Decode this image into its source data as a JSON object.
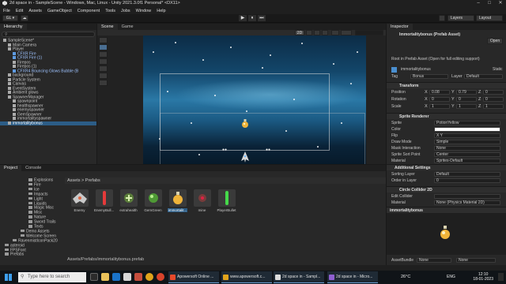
{
  "window": {
    "title": "2d space in - SampleScene - Windows, Mac, Linux - Unity 2021.3.0f1 Personal* <DX11>",
    "controls": [
      "–",
      "□",
      "✕"
    ]
  },
  "menu": [
    "File",
    "Edit",
    "Assets",
    "GameObject",
    "Component",
    "Tools",
    "Jobs",
    "Window",
    "Help"
  ],
  "toolbar": {
    "account": "GL ▾",
    "cloud": "☁",
    "play": "▶",
    "pause": "⏸",
    "step": "⏭",
    "layers": "Layers",
    "layout": "Layout"
  },
  "hierarchy": {
    "tab": "Hierarchy",
    "search_placeholder": "All",
    "items": [
      {
        "label": "SampleScene*",
        "depth": 0,
        "color": "white"
      },
      {
        "label": "Main Camera",
        "depth": 1,
        "color": "white"
      },
      {
        "label": "Player",
        "depth": 1,
        "color": "white"
      },
      {
        "label": "CFXR Fire",
        "depth": 2,
        "color": "blue"
      },
      {
        "label": "CFXR Fire (1)",
        "depth": 2,
        "color": "blue"
      },
      {
        "label": "Firepos",
        "depth": 2,
        "color": "white"
      },
      {
        "label": "Firepos (1)",
        "depth": 2,
        "color": "white"
      },
      {
        "label": "CFXR4 Bouncing Glows Bubble (B",
        "depth": 2,
        "color": "blue"
      },
      {
        "label": "background",
        "depth": 1,
        "color": "white"
      },
      {
        "label": "Particle System",
        "depth": 1,
        "color": "white"
      },
      {
        "label": "Canvas",
        "depth": 1,
        "color": "white"
      },
      {
        "label": "EventSystem",
        "depth": 1,
        "color": "white"
      },
      {
        "label": "Ambient glows",
        "depth": 1,
        "color": "white"
      },
      {
        "label": "SpawnerManager",
        "depth": 1,
        "color": "white"
      },
      {
        "label": "spawnpoint",
        "depth": 2,
        "color": "white"
      },
      {
        "label": "healthspawner",
        "depth": 2,
        "color": "white"
      },
      {
        "label": "enemyspawner",
        "depth": 2,
        "color": "white"
      },
      {
        "label": "GemSpawner",
        "depth": 2,
        "color": "white"
      },
      {
        "label": "immortalityspawner",
        "depth": 2,
        "color": "white"
      },
      {
        "label": "immortalitybonus",
        "depth": 1,
        "color": "selected"
      }
    ]
  },
  "scene": {
    "tabs": [
      "Scene",
      "Game"
    ],
    "mode_2d": "2D"
  },
  "inspector": {
    "tab": "Inspector",
    "title": "Immortalitybonus (Prefab Asset)",
    "open_label": "Open",
    "root_note": "Root in Prefab Asset (Open for full editing support)",
    "object_name": "immortalitybonus",
    "static_label": "Static",
    "tag_label": "Tag",
    "tag_value": "Bonus",
    "layer_label": "Layer",
    "layer_value": "Default",
    "transform": {
      "header": "Transform",
      "position": {
        "label": "Position",
        "x": "0.08",
        "y": "0.79",
        "z": "0"
      },
      "rotation": {
        "label": "Rotation",
        "x": "0",
        "y": "0",
        "z": "0"
      },
      "scale": {
        "label": "Scale",
        "x": "1",
        "y": "1",
        "z": "1"
      }
    },
    "sprite_renderer": {
      "header": "Sprite Renderer",
      "fields": [
        {
          "label": "Sprite",
          "value": "PotionYellow"
        },
        {
          "label": "Color",
          "value": ""
        },
        {
          "label": "Flip",
          "value": "X   Y"
        },
        {
          "label": "Draw Mode",
          "value": "Simple"
        },
        {
          "label": "Mask Interaction",
          "value": "None"
        },
        {
          "label": "Sprite Sort Point",
          "value": "Center"
        },
        {
          "label": "Material",
          "value": "Sprites-Default"
        }
      ]
    },
    "additional_settings": {
      "header": "Additional Settings",
      "fields": [
        {
          "label": "Sorting Layer",
          "value": "Default"
        },
        {
          "label": "Order in Layer",
          "value": "0"
        }
      ]
    },
    "circle_collider": {
      "header": "Circle Collider 2D",
      "fields": [
        {
          "label": "Edit Collider",
          "value": ""
        },
        {
          "label": "Material",
          "value": "None (Physics Material 2D)"
        }
      ]
    },
    "preview_title": "immortalitybonus",
    "asset_bundle_label": "AssetBundle",
    "asset_bundle_value": "None",
    "asset_bundle_variant": "None"
  },
  "project": {
    "tabs": [
      "Project",
      "Console"
    ],
    "breadcrumb": "Assets > Prefabs",
    "folders": [
      {
        "label": "Explosions",
        "depth": 3
      },
      {
        "label": "Fire",
        "depth": 3
      },
      {
        "label": "Ice",
        "depth": 3
      },
      {
        "label": "Impacts",
        "depth": 3
      },
      {
        "label": "Light",
        "depth": 3
      },
      {
        "label": "Liquids",
        "depth": 3
      },
      {
        "label": "Magic Misc",
        "depth": 3
      },
      {
        "label": "Misc",
        "depth": 3
      },
      {
        "label": "Nature",
        "depth": 3
      },
      {
        "label": "Sword Trails",
        "depth": 3
      },
      {
        "label": "Texts",
        "depth": 3
      },
      {
        "label": "Demo Assets",
        "depth": 2
      },
      {
        "label": "Welcome Screen",
        "depth": 2
      },
      {
        "label": "RavenmistIconPack20",
        "depth": 1
      },
      {
        "label": "asteroid",
        "depth": 0
      },
      {
        "label": "FPSFont",
        "depth": 0
      },
      {
        "label": "Prefabs",
        "depth": 0
      }
    ],
    "assets": [
      {
        "label": "Enemy",
        "kind": "enemy"
      },
      {
        "label": "EnemyBull...",
        "kind": "redbullet"
      },
      {
        "label": "extrahealth",
        "kind": "health"
      },
      {
        "label": "GemGreen",
        "kind": "gem"
      },
      {
        "label": "immortalit...",
        "kind": "potion",
        "selected": true
      },
      {
        "label": "mine",
        "kind": "mine"
      },
      {
        "label": "PlayerBullet",
        "kind": "greenbullet"
      }
    ],
    "footer_path": "Assets/Prefabs/immortalitybonus.prefab"
  },
  "taskbar": {
    "search_placeholder": "Type here to search",
    "windows": [
      {
        "label": "Apowersoft Online ...",
        "icon_color": "#e84a2b"
      },
      {
        "label": "www.apowersoft.c...",
        "icon_color": "#e0a31b"
      },
      {
        "label": "2d space in - Sampl...",
        "icon_color": "#dddddd"
      },
      {
        "label": "2d space in - Micro...",
        "icon_color": "#8f5fd1"
      }
    ],
    "weather": "26°C",
    "language": "ENG",
    "time": "12:10",
    "date": "18-01-2023"
  }
}
